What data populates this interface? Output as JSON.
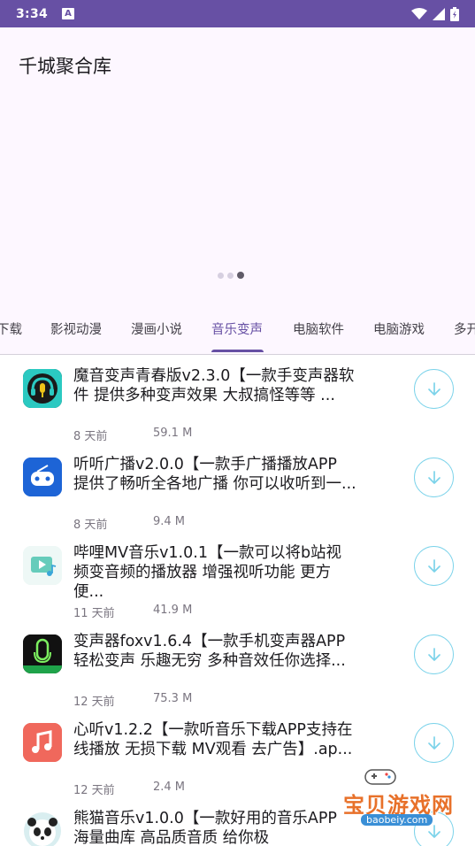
{
  "status_bar": {
    "time": "3:34",
    "notification_letter": "A"
  },
  "app": {
    "title": "千城聚合库"
  },
  "carousel": {
    "count": 3,
    "active_index": 2
  },
  "tabs": [
    {
      "label": "下载"
    },
    {
      "label": "影视动漫"
    },
    {
      "label": "漫画小说"
    },
    {
      "label": "音乐变声"
    },
    {
      "label": "电脑软件"
    },
    {
      "label": "电脑游戏"
    },
    {
      "label": "多开"
    }
  ],
  "selected_tab": "音乐变声",
  "items": [
    {
      "title": "魔音变声青春版v2.3.0【一款手变声器软件 提供多种变声效果 大叔搞怪等等 ...",
      "time": "8 天前",
      "size": "59.1 M",
      "icon": "headphone-microphone-icon"
    },
    {
      "title": "听听广播v2.0.0【一款手广播播放APP 提供了畅听全各地广播 你可以收听到一...",
      "time": "8 天前",
      "size": "9.4 M",
      "icon": "radio-gamepad-icon"
    },
    {
      "title": "哔哩MV音乐v1.0.1【一款可以将b站视频变音频的播放器 增强视听功能 更方便...",
      "time": "11 天前",
      "size": "41.9 M",
      "icon": "music-video-icon"
    },
    {
      "title": "变声器foxv1.6.4【一款手机变声器APP 轻松变声 乐趣无穷 多种音效任你选择...",
      "time": "12 天前",
      "size": "75.3 M",
      "icon": "microphone-icon"
    },
    {
      "title": "心听v1.2.2【一款听音乐下载APP支持在线播放 无损下载 MV观看 去广告】.ap...",
      "time": "12 天前",
      "size": "2.4 M",
      "icon": "music-note-icon"
    },
    {
      "title": "熊猫音乐v1.0.0【一款好用的音乐APP 海量曲库 高品质音质 给你极",
      "time": "",
      "size": "",
      "icon": "panda-icon"
    }
  ],
  "watermark": {
    "text": "宝贝游戏网",
    "url": "baobeiy.com"
  },
  "colors": {
    "status_bar": "#6750a4",
    "accent": "#6750a4",
    "download_ring": "#7cd3ea",
    "header_bg": "#fdf7ff"
  }
}
